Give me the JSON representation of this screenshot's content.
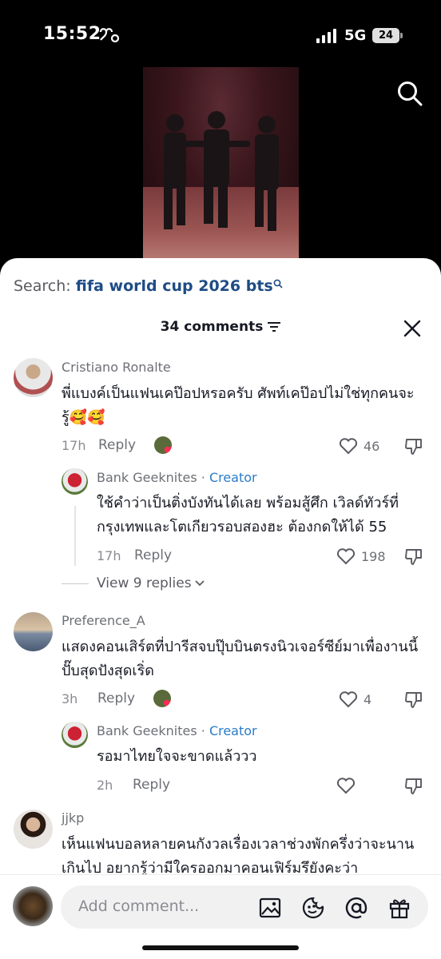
{
  "status_bar": {
    "time": "15:52",
    "network": "5G",
    "battery": "24"
  },
  "search": {
    "label": "Search:",
    "query": "fifa world cup 2026 bts"
  },
  "comments_header": {
    "count_label": "34 comments"
  },
  "comments": [
    {
      "user": "Cristiano Ronalte",
      "text": "พี่แบงค์เป็นแฟนเคป๊อปหรอครับ ศัพท์เคป๊อปไม่ใช่ทุกคนจะรู้🥰🥰",
      "time": "17h",
      "reply_label": "Reply",
      "likes": "46",
      "replies": [
        {
          "user": "Bank Geeknites",
          "separator": " · ",
          "badge": "Creator",
          "text": "ใช้คำว่าเป็นติ่งบังทันได้เลย พร้อมสู้ศึก เวิลด์ทัวร์ที่กรุงเทพและโตเกียวรอบสองฮะ ต้องกดให้ได้ 55",
          "time": "17h",
          "reply_label": "Reply",
          "likes": "198"
        }
      ],
      "view_replies": "View 9 replies"
    },
    {
      "user": "Preference_A",
      "text": "แสดงคอนเสิร์ตที่ปารีสจบปุ๊บบินตรงนิวเจอร์ซีย์มาเพื่องานนี้ปั๊บสุดปังสุดเริ่ด",
      "time": "3h",
      "reply_label": "Reply",
      "likes": "4",
      "replies": [
        {
          "user": "Bank Geeknites",
          "separator": " · ",
          "badge": "Creator",
          "text": "รอมาไทยใจจะขาดแล้ววว",
          "time": "2h",
          "reply_label": "Reply"
        }
      ]
    },
    {
      "user": "jjkp",
      "text": "เห็นแฟนบอลหลายคนกังวลเรื่องเวลาช่วงพักครึ่งว่าจะนานเกินไป อยากรู้ว่ามีใครออกมาคอนเฟิร์มรึยังคะว่า"
    }
  ],
  "composer": {
    "placeholder": "Add comment..."
  },
  "icons": [
    "health-icon",
    "signal-icon",
    "search-icon",
    "filter-icon",
    "close-icon",
    "heart-outline-icon",
    "dislike-icon",
    "chevron-down-icon",
    "image-icon",
    "emoji-icon",
    "mention-icon",
    "gift-icon"
  ],
  "colors": {
    "link_blue": "#1e4c86",
    "creator_blue": "#2a7cc7",
    "sheet_bg": "#ffffff"
  }
}
